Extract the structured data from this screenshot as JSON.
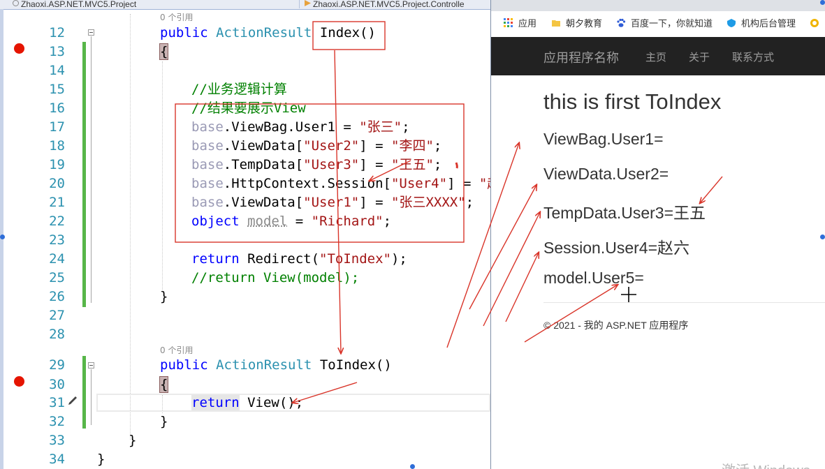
{
  "editor": {
    "tabs": [
      {
        "label": "Zhaoxi.ASP.NET.MVC5.Project"
      },
      {
        "label": "Zhaoxi.ASP.NET.MVC5.Project.Controlle"
      }
    ],
    "references": [
      "0 个引用",
      "0 个引用"
    ],
    "line_numbers": [
      "12",
      "13",
      "14",
      "15",
      "16",
      "17",
      "18",
      "19",
      "20",
      "21",
      "22",
      "23",
      "24",
      "25",
      "26",
      "27",
      "28",
      "29",
      "30",
      "31",
      "32",
      "33",
      "34"
    ],
    "code": {
      "l12_kw": "public",
      "l12_type": "ActionResult",
      "l12_name": "Index()",
      "l13": "{",
      "l15": "//业务逻辑计算",
      "l16": "//结果要展示View",
      "l17_a": "base",
      "l17_b": ".ViewBag.User1 = ",
      "l17_c": "\"张三\"",
      "l17_d": ";",
      "l18_a": "base",
      "l18_b": ".ViewData[",
      "l18_c": "\"User2\"",
      "l18_d": "] = ",
      "l18_e": "\"李四\"",
      "l18_f": ";",
      "l19_a": "base",
      "l19_b": ".TempData[",
      "l19_c": "\"User3\"",
      "l19_d": "] = ",
      "l19_e": "\"王五\"",
      "l19_f": ";",
      "l20_a": "base",
      "l20_b": ".HttpContext.Session[",
      "l20_c": "\"User4\"",
      "l20_d": "] = ",
      "l20_e": "\"赵",
      "l21_a": "base",
      "l21_b": ".ViewData[",
      "l21_c": "\"User1\"",
      "l21_d": "] = ",
      "l21_e": "\"张三XXXX\"",
      "l21_f": ";",
      "l22_a": "object",
      "l22_b": "model",
      "l22_c": " = ",
      "l22_d": "\"Richard\"",
      "l22_e": ";",
      "l24_a": "return",
      "l24_b": " Redirect(",
      "l24_c": "\"ToIndex\"",
      "l24_d": ");",
      "l25": "//return View(model);",
      "l26": "}",
      "l29_kw": "public",
      "l29_type": "ActionResult",
      "l29_name": "ToIndex()",
      "l30": "{",
      "l31_a": "return",
      "l31_b": " View();",
      "l32": "}",
      "l33": "}",
      "l34": "}"
    }
  },
  "browser": {
    "bookmarks": [
      {
        "label": "应用",
        "icon": "apps-grid-icon"
      },
      {
        "label": "朝夕教育",
        "icon": "folder-icon"
      },
      {
        "label": "百度一下，你就知道",
        "icon": "baidu-paw-icon"
      },
      {
        "label": "机构后台管理",
        "icon": "shield-icon"
      }
    ],
    "nav": {
      "brand": "应用程序名称",
      "links": [
        "主页",
        "关于",
        "联系方式"
      ]
    },
    "page": {
      "heading": "this is first ToIndex",
      "lines": [
        "ViewBag.User1=",
        "ViewData.User2=",
        "TempData.User3=王五",
        "Session.User4=赵六",
        "model.User5="
      ],
      "footer": "© 2021 - 我的 ASP.NET 应用程序"
    },
    "watermark": "激活 Windows"
  },
  "colors": {
    "keyword": "#0000ff",
    "type": "#2b91af",
    "string": "#a31515",
    "comment": "#008000",
    "breakpoint": "#e51400",
    "annotation": "#d9352a",
    "navbar": "#222222"
  }
}
